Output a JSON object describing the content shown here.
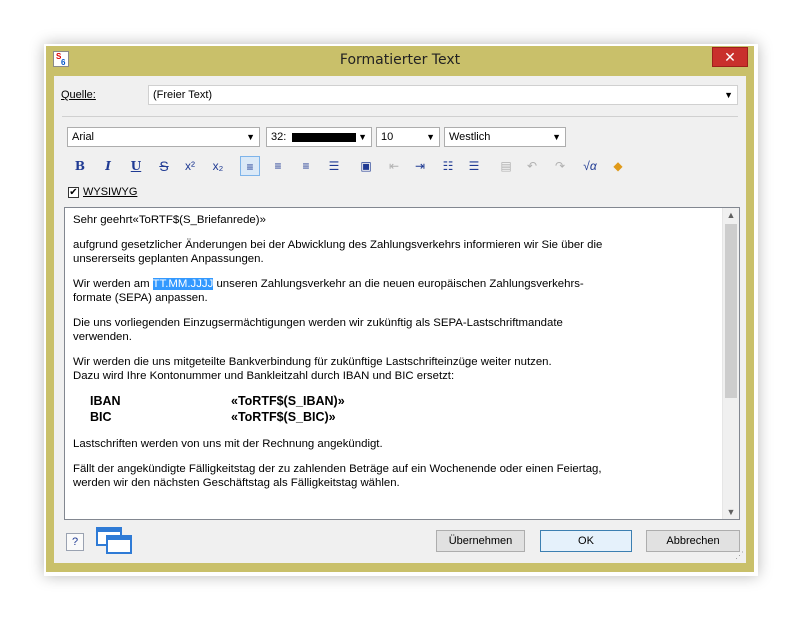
{
  "window": {
    "title": "Formatierter Text",
    "close_glyph": "✕"
  },
  "source": {
    "label": "Quelle:",
    "value": "(Freier Text)"
  },
  "font": {
    "family": "Arial",
    "size_prefix": "32:",
    "size": "10",
    "script": "Westlich"
  },
  "toolbar": {
    "bold": "B",
    "italic": "I",
    "underline": "U",
    "strike": "S",
    "superscript": "x²",
    "subscript": "x₂"
  },
  "wysiwyg": {
    "label": "WYSIWYG",
    "checked": "✔"
  },
  "document": {
    "salutation": "Sehr geehrt«ToRTF$(S_Briefanrede)»",
    "p1": "aufgrund gesetzlicher Änderungen bei der Abwicklung des Zahlungsverkehrs informieren wir Sie über die",
    "p1b": "unsererseits geplanten Anpassungen.",
    "p2_before": "Wir werden am ",
    "p2_selected": "TT.MM.JJJJ",
    "p2_after": " unseren Zahlungsverkehr an die neuen europäischen Zahlungsverkehrs-",
    "p2b": "formate (SEPA) anpassen.",
    "p3": "Die uns vorliegenden Einzugsermächtigungen werden wir zukünftig als SEPA-Lastschriftmandate",
    "p3b": "verwenden.",
    "p4": "Wir werden die uns mitgeteilte Bankverbindung für zukünftige Lastschrifteinzüge weiter nutzen.",
    "p4b": "Dazu wird Ihre Kontonummer und Bankleitzahl durch IBAN und BIC ersetzt:",
    "iban_label": "IBAN",
    "iban_value": "«ToRTF$(S_IBAN)»",
    "bic_label": "BIC",
    "bic_value": "«ToRTF$(S_BIC)»",
    "p5": "Lastschriften werden von uns mit der Rechnung angekündigt.",
    "p6": "Fällt der angekündigte Fälligkeitstag der zu zahlenden Beträge auf ein Wochenende oder einen Feiertag,",
    "p6b": "werden wir den nächsten Geschäftstag als Fälligkeitstag wählen."
  },
  "buttons": {
    "apply": "Übernehmen",
    "ok": "OK",
    "cancel": "Abbrechen",
    "help": "?"
  },
  "colors": {
    "frame": "#c9c06a",
    "close": "#c9302c",
    "selection": "#3399ff"
  }
}
